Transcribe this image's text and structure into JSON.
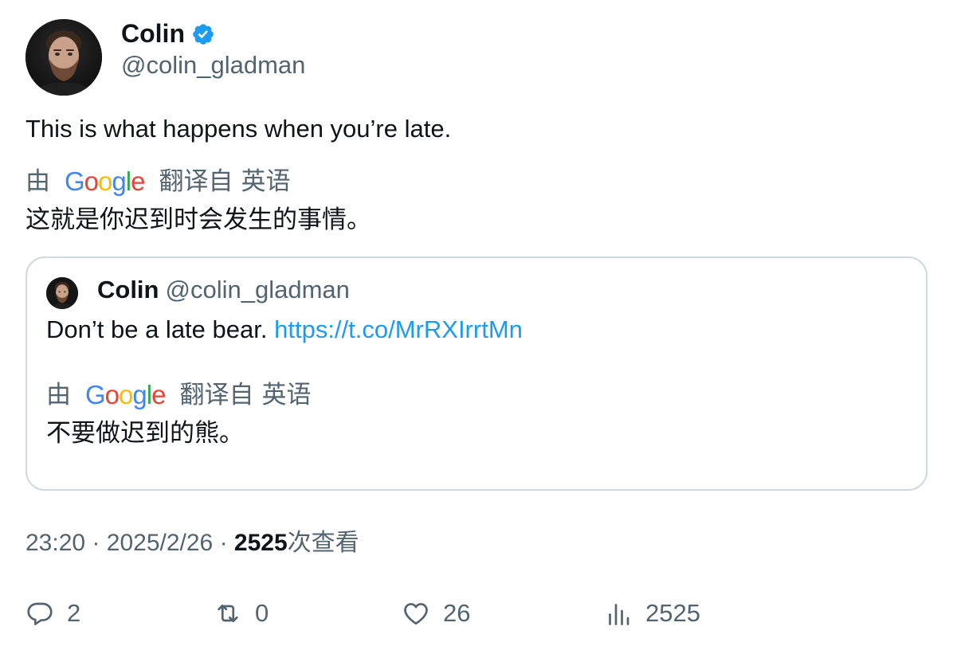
{
  "author": {
    "name": "Colin",
    "handle": "@colin_gladman",
    "verified": true
  },
  "tweet": {
    "text": "This is what happens when you’re late.",
    "translation": {
      "by": "由",
      "google_logo": [
        "G",
        "o",
        "o",
        "g",
        "l",
        "e"
      ],
      "from": "翻译自",
      "language": "英语",
      "text": "这就是你迟到时会发生的事情。"
    }
  },
  "quote": {
    "name": "Colin",
    "handle": "@colin_gladman",
    "text": "Don’t be a late bear.",
    "link": "https://t.co/MrRXIrrtMn",
    "translation": {
      "by": "由",
      "from": "翻译自",
      "language": "英语",
      "text": "不要做迟到的熊。"
    }
  },
  "meta": {
    "time": "23:20",
    "separator": "·",
    "date": "2025/2/26",
    "views_count": "2525",
    "views_label": "次查看"
  },
  "actions": {
    "replies": "2",
    "retweets": "0",
    "likes": "26",
    "views": "2525"
  },
  "colors": {
    "text_primary": "#0f1419",
    "text_secondary": "#536471",
    "link": "#1d9bf0",
    "verified": "#1d9bf0",
    "border": "#cfd9de",
    "google_blue": "#4285f4",
    "google_red": "#ea4335",
    "google_yellow": "#fbbc05",
    "google_green": "#34a853"
  },
  "icons": {
    "verified": "verified-badge-icon",
    "reply": "reply-icon",
    "retweet": "retweet-icon",
    "like": "heart-icon",
    "views": "views-chart-icon"
  }
}
